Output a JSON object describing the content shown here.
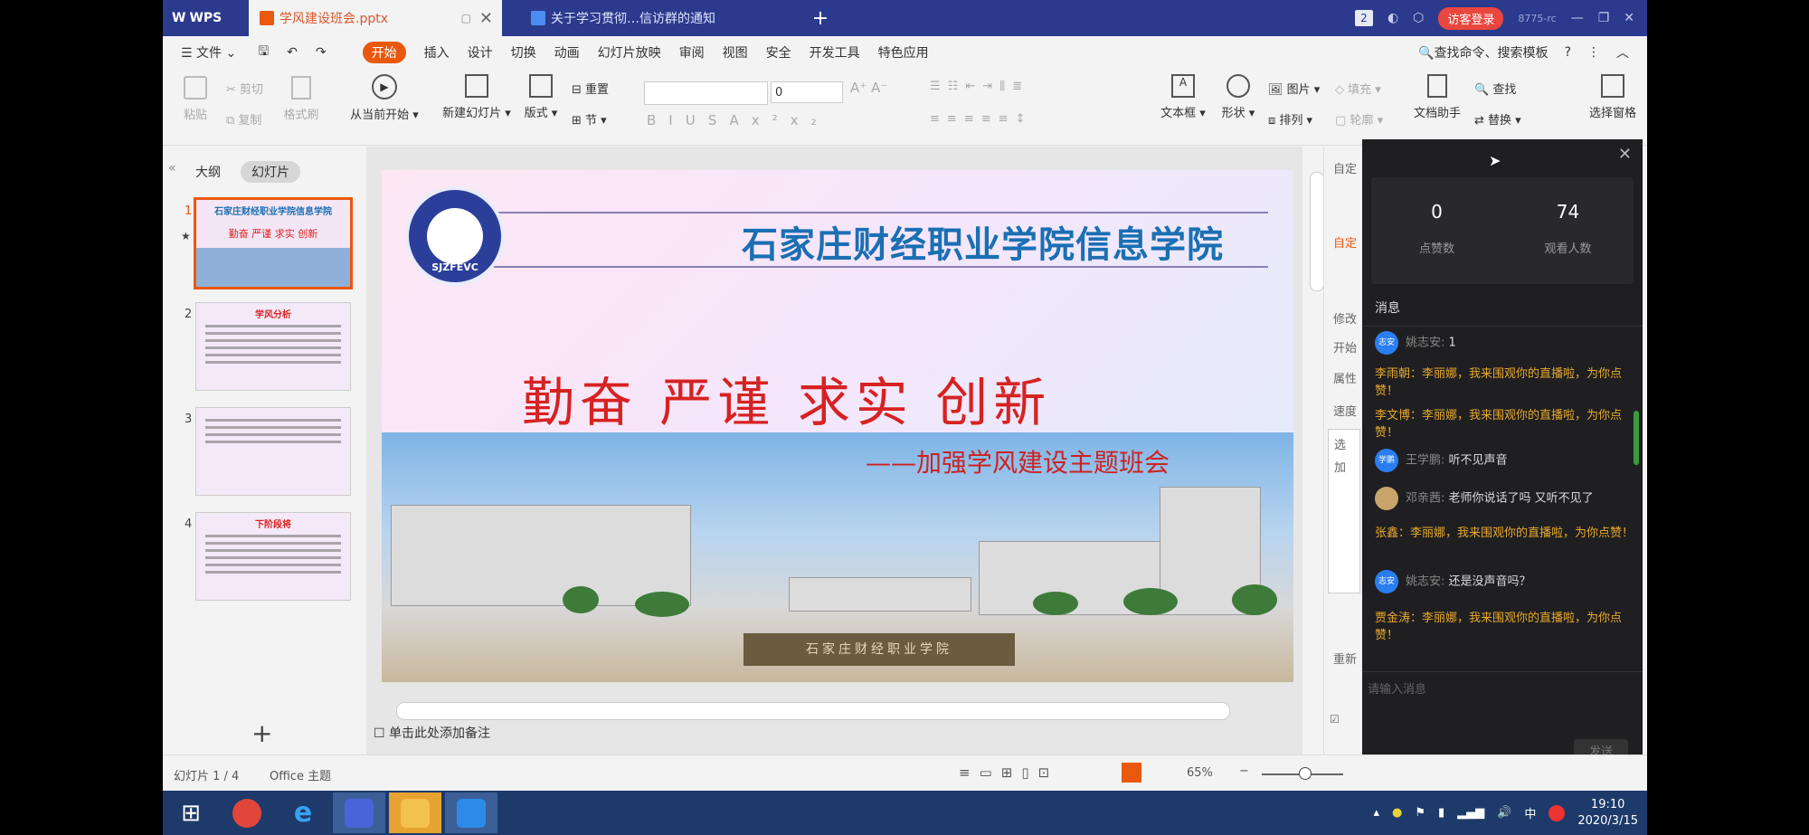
{
  "tabs": {
    "app": "WPS",
    "doc1": "学风建设班会.pptx",
    "doc2": "关于学习贯彻…信访群的通知",
    "plus": "+",
    "badge": "2",
    "visitor": "访客登录",
    "user_label": "8775-rc"
  },
  "menu": {
    "file": "文件",
    "items": [
      "开始",
      "插入",
      "设计",
      "切换",
      "动画",
      "幻灯片放映",
      "审阅",
      "视图",
      "安全",
      "开发工具",
      "特色应用"
    ],
    "search": "查找命令、搜索模板",
    "help": "?"
  },
  "ribbon": {
    "paste": "粘贴",
    "cut": "剪切",
    "copy": "复制",
    "format_painter": "格式刷",
    "play_from_current": "从当前开始",
    "new_slide": "新建幻灯片",
    "layout": "版式",
    "reset": "重置",
    "section": "节",
    "font_size": "0",
    "textbox": "文本框",
    "shape": "形状",
    "arrange": "排列",
    "picture": "图片",
    "fill": "填充",
    "outline": "轮廓",
    "doc_assistant": "文档助手",
    "find": "查找",
    "replace": "替换",
    "select_pane": "选择窗格"
  },
  "left_panel": {
    "tab_outline": "大纲",
    "tab_slides": "幻灯片",
    "thumbs": [
      {
        "num": "1",
        "title": "石家庄财经职业学院信息学院"
      },
      {
        "num": "2",
        "title": "学风分析"
      },
      {
        "num": "3",
        "title": ""
      },
      {
        "num": "4",
        "title": "下阶段将"
      }
    ],
    "add": "+"
  },
  "slide": {
    "logo_text": "SJZFEVC",
    "school": "石家庄财经职业学院信息学院",
    "motto": "勤奋 严谨 求实 创新",
    "subtitle": "——加强学风建设主题班会",
    "stone_text": "石家庄财经职业学院"
  },
  "notes": "单击此处添加备注",
  "right_pane": {
    "l1": "自定",
    "l2": "自定",
    "l3": "修改",
    "l4": "开始",
    "l5": "属性",
    "l6": "速度",
    "l7": "选",
    "l8": "加",
    "l9": "重新"
  },
  "live": {
    "likes": "0",
    "likes_label": "点赞数",
    "viewers": "74",
    "viewers_label": "观看人数",
    "messages_header": "消息",
    "messages": [
      {
        "type": "chat",
        "avatar": "志安",
        "name": "姚志安:",
        "text": "1"
      },
      {
        "type": "gift",
        "text": "李雨朝：李丽娜，我来围观你的直播啦，为你点赞！"
      },
      {
        "type": "gift",
        "text": "李文博：李丽娜，我来围观你的直播啦，为你点赞！"
      },
      {
        "type": "chat",
        "avatar": "学鹏",
        "name": "王学鹏:",
        "text": "听不见声音"
      },
      {
        "type": "chat",
        "avatar": "",
        "name": "邓亲茜:",
        "text": "老师你说话了吗 又听不见了"
      },
      {
        "type": "gift",
        "text": "张鑫：李丽娜，我来围观你的直播啦，为你点赞！"
      },
      {
        "type": "chat",
        "avatar": "志安",
        "name": "姚志安:",
        "text": "还是没声音吗？"
      },
      {
        "type": "gift",
        "text": "贾金涛：李丽娜，我来围观你的直播啦，为你点赞！"
      }
    ],
    "input_placeholder": "请输入消息",
    "send": "发送"
  },
  "statusbar": {
    "slide_count": "幻灯片 1 / 4",
    "theme": "Office 主题",
    "zoom": "65%",
    "zoom_minus": "−"
  },
  "taskbar": {
    "time": "19:10",
    "date": "2020/3/15",
    "ime": "中"
  }
}
